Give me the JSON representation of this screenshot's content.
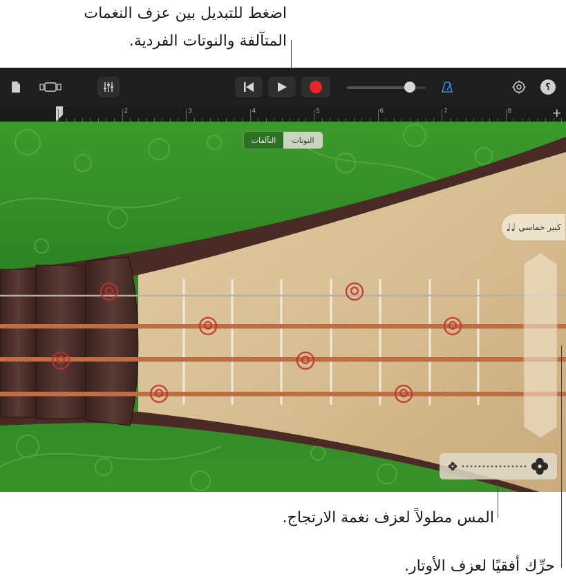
{
  "callouts": {
    "toggle_line1": "اضغط للتبديل بين عزف النغمات",
    "toggle_line2": "المتآلفة والنوتات الفردية.",
    "tremolo": "المس مطولاً لعزف نغمة الارتجاج.",
    "strum": "حرِّك أفقيًا لعزف الأوتار."
  },
  "toolbar": {
    "icons": [
      "document-icon",
      "tracks-view-icon",
      "mixer-icon",
      "go-to-beginning-icon",
      "play-icon",
      "record-icon",
      "master-volume-slider",
      "metronome-icon",
      "settings-icon",
      "help-icon"
    ],
    "record_color": "#e8262a",
    "metronome_color": "#2f8cf0",
    "help_label": "؟",
    "volume_level": 0.8
  },
  "ruler": {
    "bars": [
      "1",
      "2",
      "3",
      "4",
      "5",
      "6",
      "7",
      "8"
    ],
    "add_label": "+"
  },
  "instrument": {
    "mode_toggle": {
      "notes_label": "النوتات",
      "chords_label": "التآلفات",
      "selected": "النوتات"
    },
    "scale_label": "كبير خماسي",
    "scale_icon": "♩♩",
    "body_color": "#2f8a28",
    "string_color": "#d07a4a",
    "note_marker_color": "#c0302e"
  }
}
